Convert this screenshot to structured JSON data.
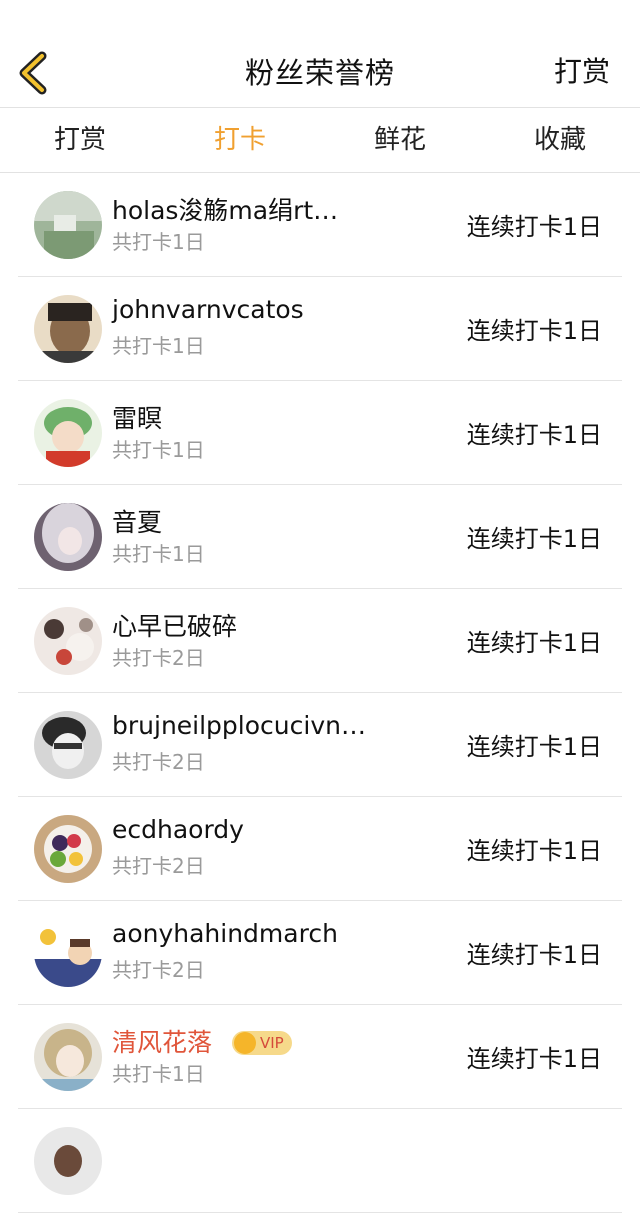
{
  "header": {
    "title": "粉丝荣誉榜",
    "action": "打赏"
  },
  "tabs": [
    {
      "label": "打赏"
    },
    {
      "label": "打卡"
    },
    {
      "label": "鲜花"
    },
    {
      "label": "收藏"
    }
  ],
  "active_tab": 1,
  "accent_color": "#f0a030",
  "vip_name_color": "#e0553a",
  "rows": [
    {
      "name": "holas浚觞ma绢rt…",
      "total": "共打卡1日",
      "streak": "连续打卡1日",
      "avatar": "avatar-photo"
    },
    {
      "name": "johnvarnvcatos",
      "total": "共打卡1日",
      "streak": "连续打卡1日",
      "avatar": "avatar-photo"
    },
    {
      "name": "雷瞑",
      "total": "共打卡1日",
      "streak": "连续打卡1日",
      "avatar": "avatar-photo"
    },
    {
      "name": "音夏",
      "total": "共打卡1日",
      "streak": "连续打卡1日",
      "avatar": "avatar-photo"
    },
    {
      "name": "心早已破碎",
      "total": "共打卡2日",
      "streak": "连续打卡1日",
      "avatar": "avatar-photo"
    },
    {
      "name": "brujneilpplocucivn…",
      "total": "共打卡2日",
      "streak": "连续打卡1日",
      "avatar": "avatar-photo"
    },
    {
      "name": "ecdhaordy",
      "total": "共打卡2日",
      "streak": "连续打卡1日",
      "avatar": "avatar-photo"
    },
    {
      "name": "aonyhahindmarch",
      "total": "共打卡2日",
      "streak": "连续打卡1日",
      "avatar": "avatar-photo"
    },
    {
      "name": "清风花落",
      "total": "共打卡1日",
      "streak": "连续打卡1日",
      "avatar": "avatar-photo",
      "vip": "VIP"
    }
  ]
}
